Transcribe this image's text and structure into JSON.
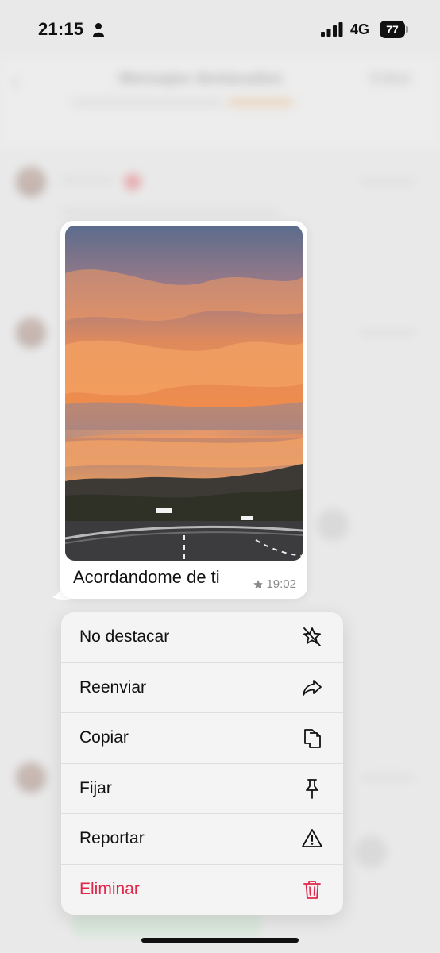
{
  "status_bar": {
    "time": "21:15",
    "network": "4G",
    "battery": "77"
  },
  "background": {
    "title": "Mensajes destacados",
    "edit_label": "Editar",
    "back_icon": "chevron-left-icon"
  },
  "message": {
    "caption": "Acordandome de ti",
    "time": "19:02",
    "starred": true,
    "image": "sunset-over-hills-photo"
  },
  "context_menu": {
    "items": [
      {
        "label": "No destacar",
        "icon": "star-slash-icon",
        "danger": false
      },
      {
        "label": "Reenviar",
        "icon": "forward-arrow-icon",
        "danger": false
      },
      {
        "label": "Copiar",
        "icon": "copy-icon",
        "danger": false
      },
      {
        "label": "Fijar",
        "icon": "pin-icon",
        "danger": false
      },
      {
        "label": "Reportar",
        "icon": "warning-icon",
        "danger": false
      },
      {
        "label": "Eliminar",
        "icon": "trash-icon",
        "danger": true
      }
    ]
  },
  "colors": {
    "danger": "#e1264a",
    "menu_background": "#f4f4f4",
    "bubble_background": "#ffffff"
  }
}
